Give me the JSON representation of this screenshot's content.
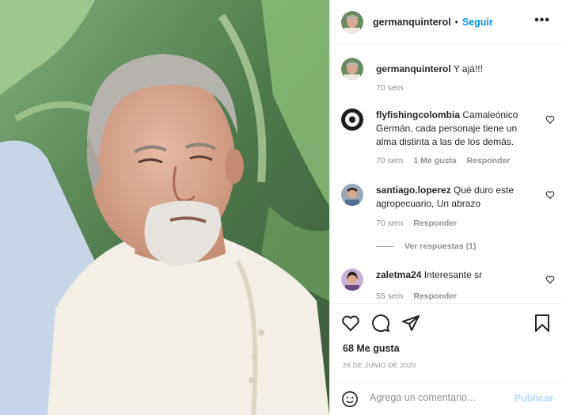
{
  "post": {
    "author": "germanquinterol",
    "separator": "•",
    "follow_label": "Seguir",
    "more_label": "•••",
    "caption": {
      "username": "germanquinterol",
      "text": "Y ajá!!!",
      "time": "70 sem"
    },
    "comments": [
      {
        "username": "flyfishingcolombia",
        "text": "Camaleónico Germán, cada personaje tiene un alma distinta a las de los demás.",
        "time": "70 sem",
        "likes": "1 Me gusta",
        "reply_label": "Responder"
      },
      {
        "username": "santiago.loperez",
        "text": "Qué duro este agropecuario, Un abrazo",
        "time": "70 sem",
        "reply_label": "Responder",
        "view_replies": "Ver respuestas (1)"
      },
      {
        "username": "zaletma24",
        "text": "Interesante sr",
        "time": "55 sem",
        "reply_label": "Responder"
      }
    ],
    "likes_count": "68 Me gusta",
    "date": "26 DE JUNIO DE 2020",
    "comment_placeholder": "Agrega un comentario...",
    "publish_label": "Publicar"
  },
  "icons": {
    "like": "heart-icon",
    "comment": "comment-icon",
    "share": "share-icon",
    "save": "bookmark-icon",
    "emoji": "emoji-icon",
    "comment_like": "heart-small-icon"
  },
  "colors": {
    "follow": "#0095f6",
    "muted": "#8e8e8e",
    "text": "#262626",
    "publish_disabled": "#b3dbff"
  }
}
